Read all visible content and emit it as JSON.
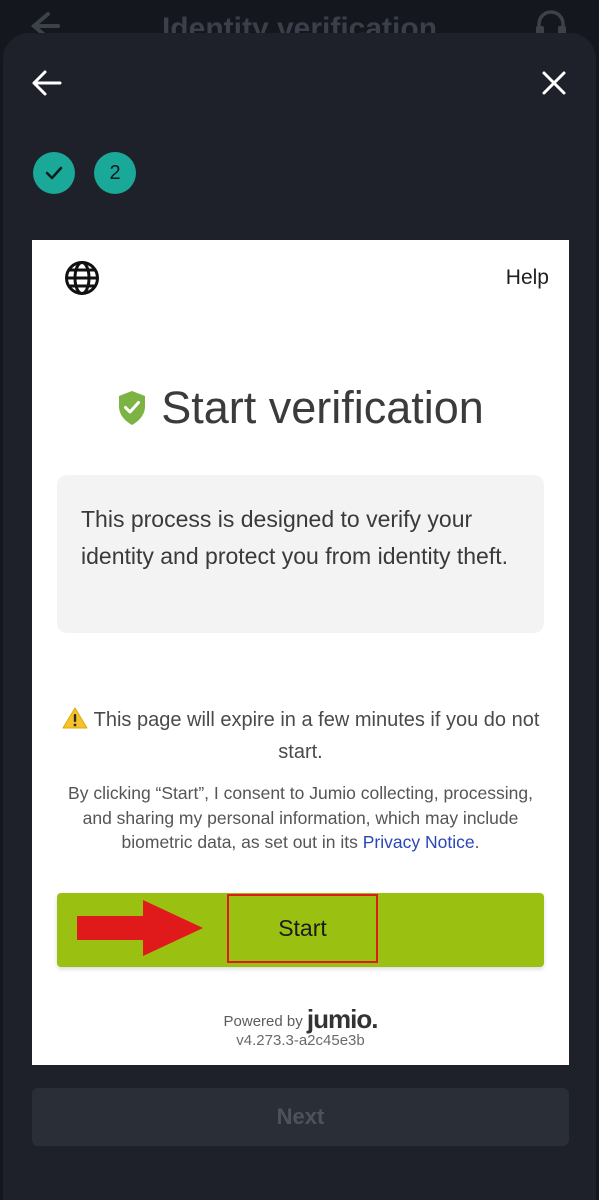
{
  "background": {
    "title": "Identity verification"
  },
  "steps": {
    "step1_icon": "check-icon",
    "step2_label": "2"
  },
  "card": {
    "help_label": "Help",
    "title": "Start verification",
    "info_text": "This process is designed to verify your identity and protect you from identity theft.",
    "warning_text": "This page will expire in a few minutes if you do not start.",
    "consent_text": "By clicking “Start”, I consent to Jumio collecting, processing, and sharing my personal information, which may include biometric data, as set out in its ",
    "privacy_link": "Privacy Notice",
    "consent_end": ".",
    "start_label": "Start",
    "powered_by": "Powered by",
    "brand": "jumio.",
    "version": "v4.273.3-a2c45e3b"
  },
  "footer": {
    "next_label": "Next"
  },
  "colors": {
    "accent_teal": "#1aa899",
    "start_green": "#9ac011",
    "shield_green": "#7cb342",
    "annotation_red": "#e0191b"
  }
}
